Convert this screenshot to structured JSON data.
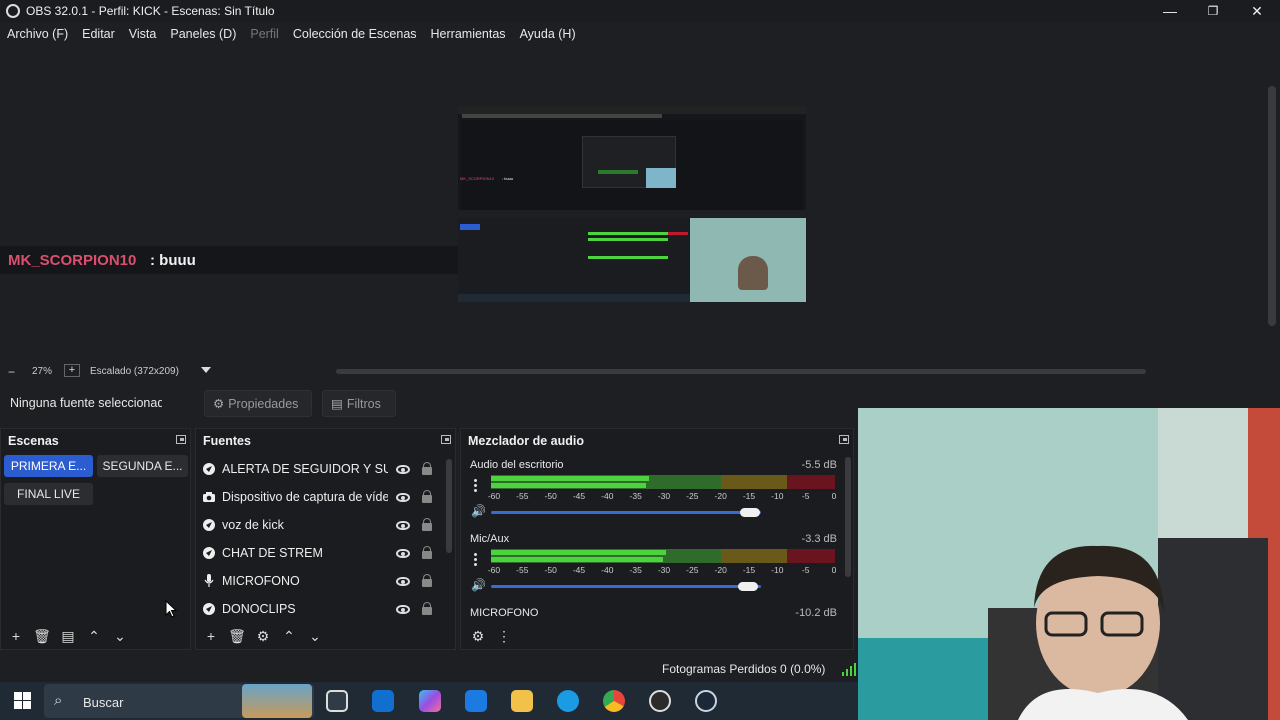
{
  "window": {
    "title": "OBS 32.0.1 - Perfil: KICK - Escenas: Sin Título",
    "minimize": "—",
    "maximize": "❐",
    "close": "✕"
  },
  "menu": [
    {
      "label": "Archivo (F)",
      "disabled": false
    },
    {
      "label": "Editar",
      "disabled": false
    },
    {
      "label": "Vista",
      "disabled": false
    },
    {
      "label": "Paneles (D)",
      "disabled": false
    },
    {
      "label": "Perfil",
      "disabled": true
    },
    {
      "label": "Colección de Escenas",
      "disabled": false
    },
    {
      "label": "Herramientas",
      "disabled": false
    },
    {
      "label": "Ayuda (H)",
      "disabled": false
    }
  ],
  "preview": {
    "chat_user": "MK_SCORPION10",
    "chat_message": ": buuu",
    "mini_chat_user": "MK_SCORPION10",
    "mini_chat_message": ": buuu"
  },
  "zoom": {
    "minus": "−",
    "value": "27%",
    "plus": "+",
    "mode": "Escalado (372x209)"
  },
  "source_toolbar": {
    "no_source": "Ninguna fuente seleccionad",
    "properties": "Propiedades",
    "filters": "Filtros"
  },
  "scenes": {
    "title": "Escenas",
    "items": [
      {
        "label": "PRIMERA E...",
        "active": true
      },
      {
        "label": "SEGUNDA E...",
        "active": false
      },
      {
        "label": "FINAL LIVE",
        "active": false
      }
    ]
  },
  "sources": {
    "title": "Fuentes",
    "items": [
      {
        "label": "ALERTA DE SEGUIDOR Y SUSC",
        "icon": "browser-icon"
      },
      {
        "label": "Dispositivo de captura de vídeo",
        "icon": "camera-icon"
      },
      {
        "label": "voz de kick",
        "icon": "browser-icon"
      },
      {
        "label": "CHAT DE STREM",
        "icon": "browser-icon"
      },
      {
        "label": "MICROFONO",
        "icon": "microphone-icon"
      },
      {
        "label": "DONOCLIPS",
        "icon": "browser-icon"
      }
    ]
  },
  "mixer": {
    "title": "Mezclador de audio",
    "scale": [
      "-60",
      "-55",
      "-50",
      "-45",
      "-40",
      "-35",
      "-30",
      "-25",
      "-20",
      "-15",
      "-10",
      "-5",
      "0"
    ],
    "channels": [
      {
        "name": "Audio del escritorio",
        "db": "-5.5 dB",
        "level": 0.46,
        "volume": 0.96
      },
      {
        "name": "Mic/Aux",
        "db": "-3.3 dB",
        "level": 0.51,
        "volume": 0.95
      },
      {
        "name": "MICROFONO",
        "db": "-10.2 dB"
      }
    ]
  },
  "status": {
    "dropped_frames": "Fotogramas Perdidos 0 (0.0%)"
  },
  "taskbar": {
    "search": "Buscar"
  },
  "colors": {
    "accent": "#2b5cd0",
    "chat_user": "#d9506f",
    "meter_green": "#4cd33f",
    "meter_yellow": "#b49b1d",
    "meter_red": "#c0182e"
  }
}
